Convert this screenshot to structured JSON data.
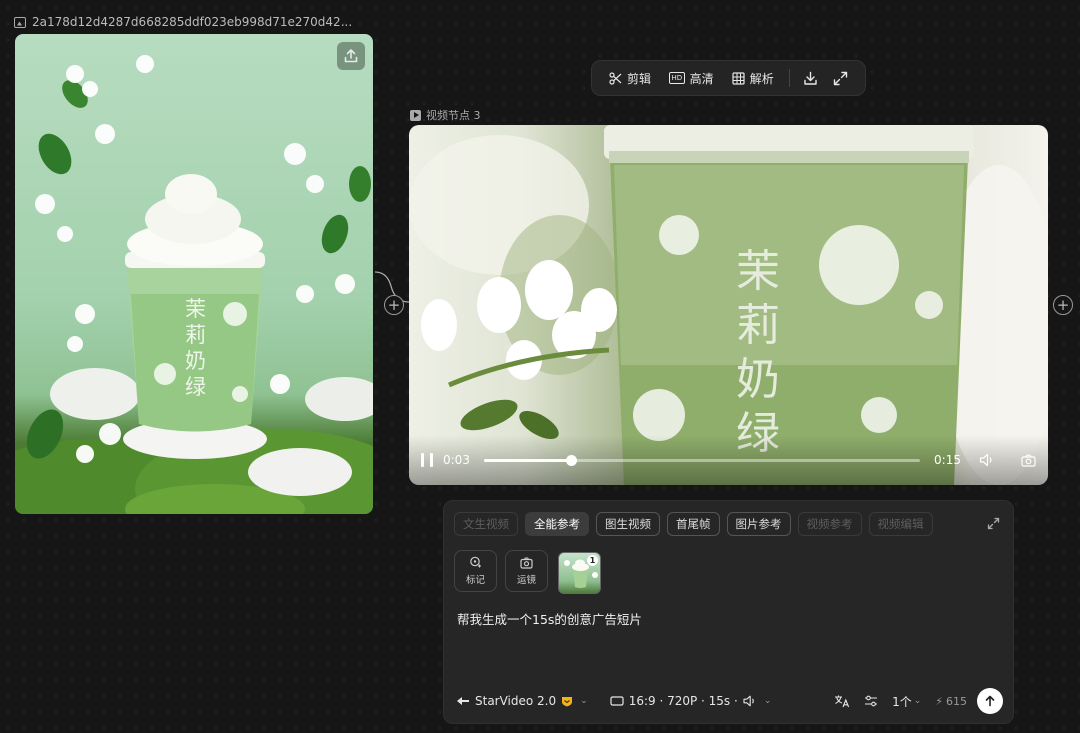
{
  "image_node": {
    "title": "2a178d12d4287d668285ddf023eb998d71e270d42...",
    "cup_text": "茉莉奶绿"
  },
  "toolbar": {
    "cut_label": "剪辑",
    "hd_label": "高清",
    "analyze_label": "解析",
    "hd_badge": "HD"
  },
  "video_node": {
    "title": "视频节点 3",
    "cup_text": "茉莉奶绿",
    "current_time": "0:03",
    "duration": "0:15",
    "progress": 0.2
  },
  "panel": {
    "tabs": [
      {
        "label": "文生视频",
        "state": "disabled"
      },
      {
        "label": "全能参考",
        "state": "active"
      },
      {
        "label": "图生视频",
        "state": "normal"
      },
      {
        "label": "首尾帧",
        "state": "normal"
      },
      {
        "label": "图片参考",
        "state": "normal"
      },
      {
        "label": "视频参考",
        "state": "disabled"
      },
      {
        "label": "视频编辑",
        "state": "disabled"
      }
    ],
    "tools": {
      "mark_label": "标记",
      "camera_label": "运镜"
    },
    "thumb_badge": "1",
    "prompt": "帮我生成一个15s的创意广告短片",
    "model": "StarVideo 2.0",
    "spec": "16:9 · 720P · 15s ·",
    "count": "1个",
    "credits": "615"
  },
  "colors": {
    "background": "#161616",
    "panel": "#262626",
    "badge_gold": "#f2b41e"
  }
}
